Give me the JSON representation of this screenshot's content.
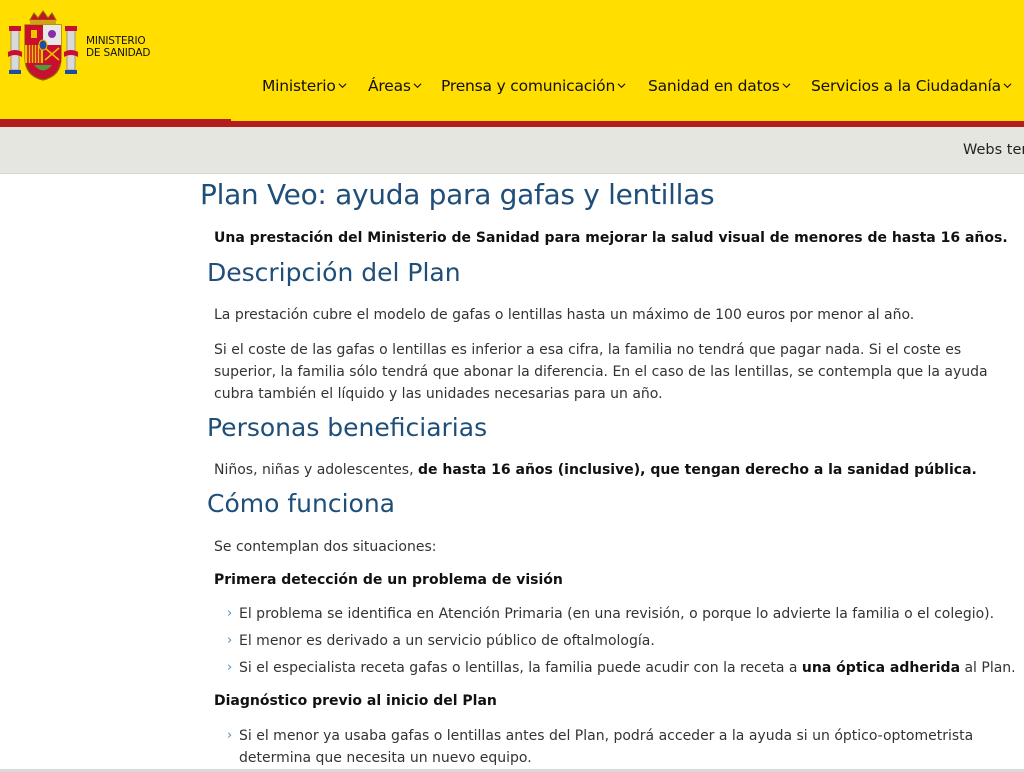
{
  "header": {
    "ministry_line1": "MINISTERIO",
    "ministry_line2": "DE SANIDAD",
    "nav": [
      {
        "label": "Ministerio"
      },
      {
        "label": "Áreas"
      },
      {
        "label": "Prensa y comunicación"
      },
      {
        "label": "Sanidad en datos"
      },
      {
        "label": "Servicios a la Ciudadanía"
      }
    ]
  },
  "subbar": {
    "link": "Webs ter"
  },
  "colors": {
    "brand_yellow": "#ffde00",
    "brand_red": "#b51d1d",
    "heading_blue": "#1f4e79",
    "bullet_blue": "#4a90c8"
  },
  "page": {
    "title": "Plan Veo: ayuda para gafas y lentillas",
    "lead": "Una prestación del Ministerio de Sanidad para mejorar la salud visual de menores de hasta 16 años.",
    "sections": {
      "descripcion": {
        "heading": "Descripción del Plan",
        "p1": "La prestación cubre el modelo de gafas o lentillas hasta un máximo de 100 euros por menor al año.",
        "p2": "Si el coste de las gafas o lentillas es inferior a esa cifra, la familia no tendrá que pagar nada. Si el coste es superior, la familia sólo tendrá que abonar la diferencia. En el caso de las lentillas, se contempla que la ayuda cubra también el líquido y las unidades necesarias para un año."
      },
      "beneficiarias": {
        "heading": "Personas beneficiarias",
        "text_plain": "Niños, niñas y adolescentes, ",
        "text_bold": "de hasta 16 años (inclusive), que tengan derecho a la sanidad pública."
      },
      "funciona": {
        "heading": "Cómo funciona",
        "intro": "Se contemplan dos situaciones:",
        "sub1": {
          "heading": "Primera detección de un problema de visión",
          "items": [
            "El problema se identifica en Atención Primaria (en una revisión, o porque lo advierte la familia o el colegio).",
            "El menor es derivado a un servicio público de oftalmología."
          ],
          "item3_plain": "Si el especialista receta gafas o lentillas, la familia puede acudir con la receta a ",
          "item3_bold": "una óptica adherida",
          "item3_tail": " al Plan."
        },
        "sub2": {
          "heading": "Diagnóstico previo al inicio del Plan",
          "item1": "Si el menor ya usaba gafas o lentillas antes del Plan, podrá acceder a la ayuda si un óptico-optometrista determina que necesita un nuevo equipo."
        }
      }
    }
  }
}
